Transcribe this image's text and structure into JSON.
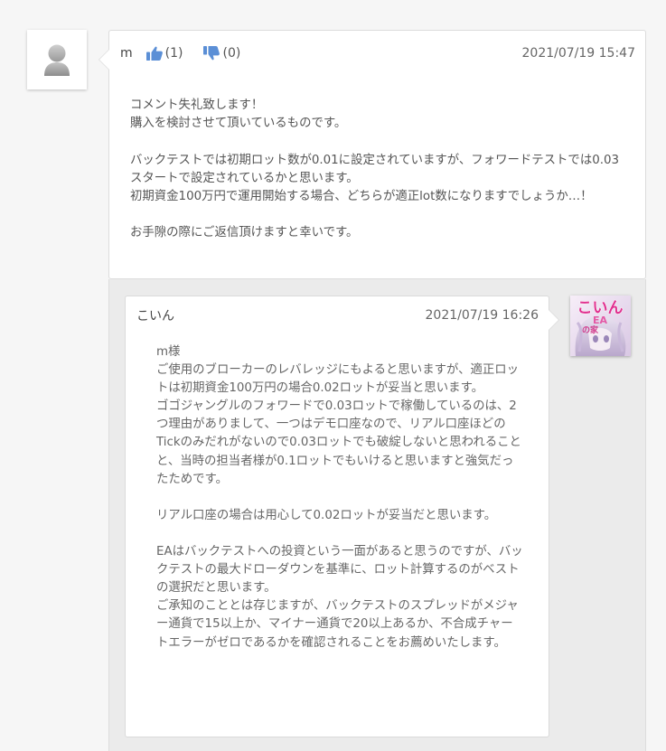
{
  "comment": {
    "author": "m",
    "likes": "(1)",
    "dislikes": "(0)",
    "timestamp": "2021/07/19 15:47",
    "paragraphs": [
      "コメント失礼致します！\n購入を検討させて頂いているものです。",
      "バックテストでは初期ロット数が0.01に設定されていますが、フォワードテストでは0.03スタートで設定されているかと思います。\n初期資金100万円で運用開始する場合、どちらが適正lot数になりますでしょうか…！",
      "お手隙の際にご返信頂けますと幸いです。"
    ]
  },
  "reply": {
    "author": "こいん",
    "timestamp": "2021/07/19 16:26",
    "paragraphs": [
      "m様\nご使用のブローカーのレバレッジにもよると思いますが、適正ロットは初期資金100万円の場合0.02ロットが妥当と思います。\nゴゴジャングルのフォワードで0.03ロットで稼働しているのは、2つ理由がありまして、一つはデモ口座なので、リアル口座ほどのTickのみだれがないので0.03ロットでも破綻しないと思われることと、当時の担当者様が0.1ロットでもいけると思いますと強気だったためです。",
      "リアル口座の場合は用心して0.02ロットが妥当だと思います。",
      "EAはバックテストへの投資という一面があると思うのですが、バックテストの最大ドローダウンを基準に、ロット計算するのがベストの選択だと思います。\nご承知のこととは存じますが、バックテストのスプレッドがメジャー通貨で15以上か、マイナー通貨で20以上あるか、不合成チャートエラーがゼロであるかを確認されることをお薦めいたします。"
    ]
  },
  "seller_avatar": {
    "logo_line1": "こいん",
    "logo_line2": "EA",
    "logo_line3": "の家"
  },
  "colors": {
    "like_icon": "#5b8fd6",
    "dislike_icon": "#5b8fd6",
    "text": "#555555",
    "reply_background": "#ebebeb"
  },
  "icons": {
    "guest_avatar": "person-silhouette-icon",
    "like": "thumbs-up-icon",
    "dislike": "thumbs-down-icon"
  }
}
